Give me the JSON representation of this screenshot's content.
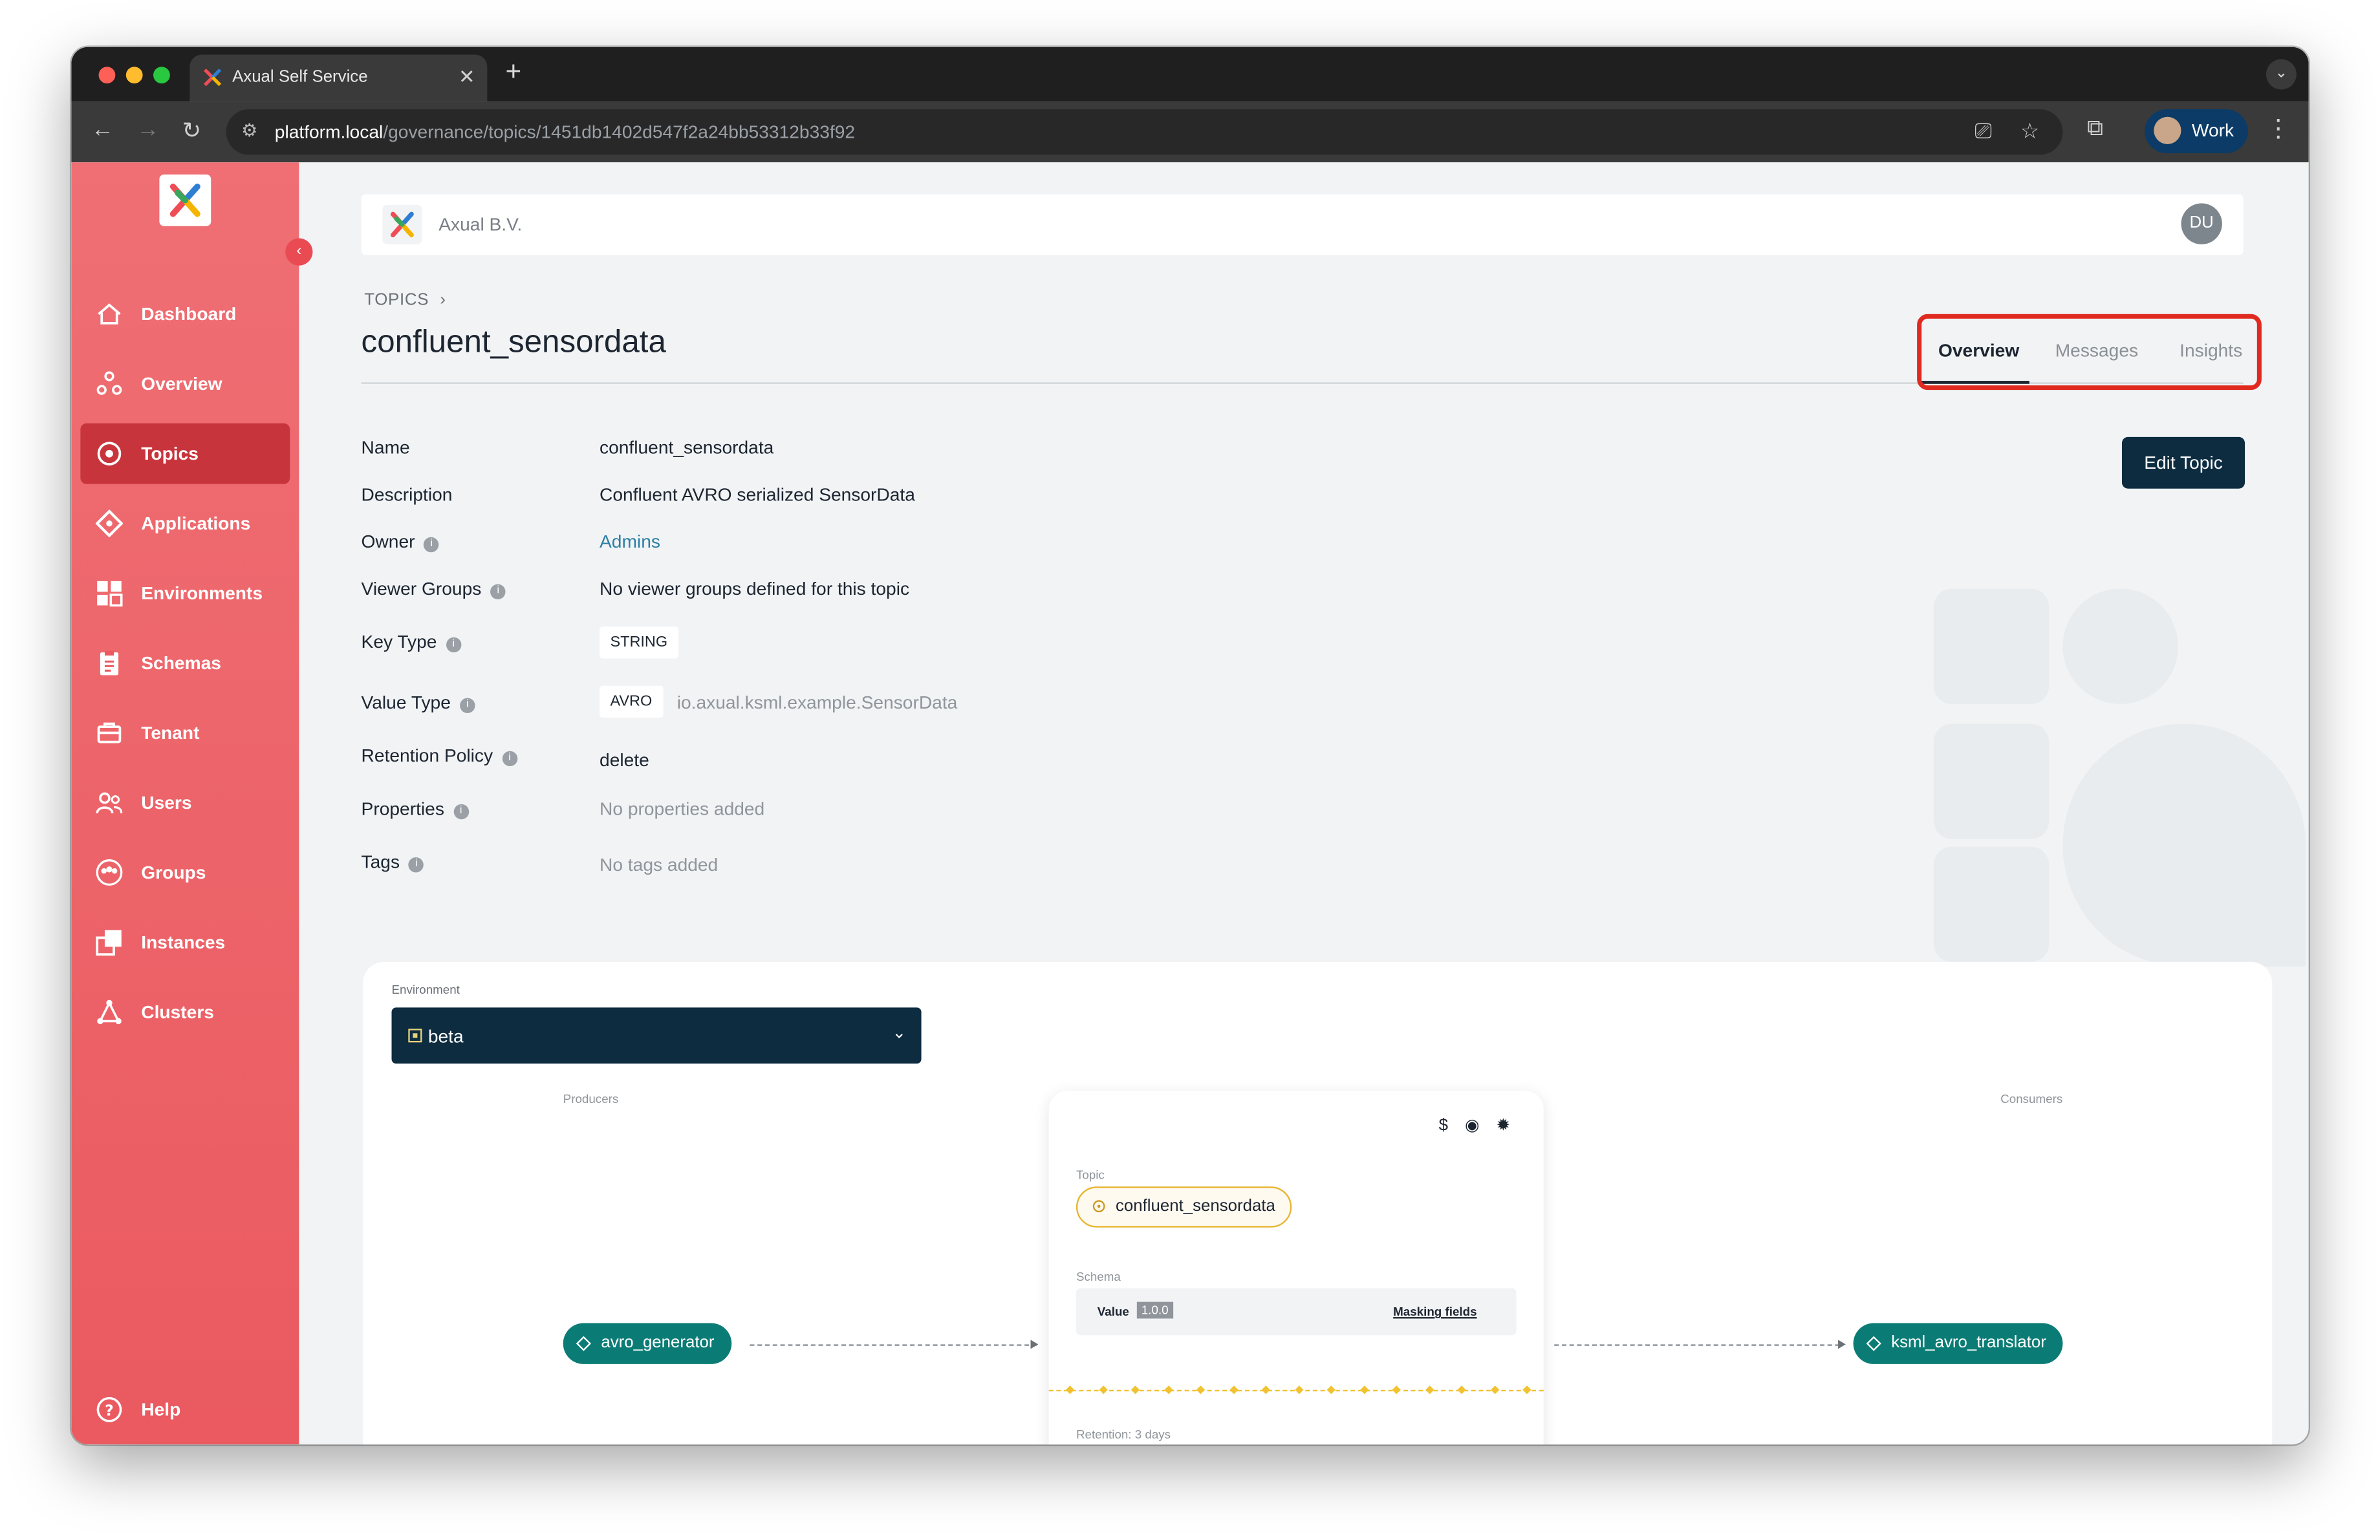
{
  "browser": {
    "tab_title": "Axual Self Service",
    "tab_close": "✕",
    "new_tab": "+",
    "tab_menu": "⌄",
    "url_host": "platform.local",
    "url_path": "/governance/topics/1451db1402d547f2a24bb53312b33f92",
    "profile_label": "Work",
    "icons": [
      "back-icon",
      "forward-icon",
      "reload-icon",
      "site-settings-icon",
      "cast-icon",
      "bookmark-star-icon",
      "extensions-icon",
      "more-menu-icon"
    ]
  },
  "sidebar": {
    "collapse_glyph": "‹",
    "items": [
      {
        "label": "Dashboard",
        "icon": "home-icon",
        "active": false
      },
      {
        "label": "Overview",
        "icon": "overview-icon",
        "active": false
      },
      {
        "label": "Topics",
        "icon": "topic-icon",
        "active": true
      },
      {
        "label": "Applications",
        "icon": "application-icon",
        "active": false
      },
      {
        "label": "Environments",
        "icon": "environment-icon",
        "active": false
      },
      {
        "label": "Schemas",
        "icon": "schema-icon",
        "active": false
      },
      {
        "label": "Tenant",
        "icon": "tenant-icon",
        "active": false
      },
      {
        "label": "Users",
        "icon": "users-icon",
        "active": false
      },
      {
        "label": "Groups",
        "icon": "groups-icon",
        "active": false
      },
      {
        "label": "Instances",
        "icon": "instances-icon",
        "active": false
      },
      {
        "label": "Clusters",
        "icon": "clusters-icon",
        "active": false
      }
    ],
    "help_label": "Help"
  },
  "header": {
    "org_name": "Axual B.V.",
    "user_initials": "DU"
  },
  "page": {
    "breadcrumb": "TOPICS",
    "title": "confluent_sensordata",
    "tabs": [
      "Overview",
      "Messages",
      "Insights"
    ],
    "active_tab": "Overview",
    "edit_button": "Edit Topic",
    "highlight_color": "#e02a1f"
  },
  "details": {
    "name_label": "Name",
    "name_value": "confluent_sensordata",
    "description_label": "Description",
    "description_value": "Confluent AVRO serialized SensorData",
    "owner_label": "Owner",
    "owner_value": "Admins",
    "viewer_groups_label": "Viewer Groups",
    "viewer_groups_value": "No viewer groups defined for this topic",
    "key_type_label": "Key Type",
    "key_type_value": "STRING",
    "value_type_label": "Value Type",
    "value_type_value": "AVRO",
    "value_type_schema": "io.axual.ksml.example.SensorData",
    "retention_label": "Retention Policy",
    "retention_value": "delete",
    "properties_label": "Properties",
    "properties_value": "No properties added",
    "tags_label": "Tags",
    "tags_value": "No tags added"
  },
  "flow": {
    "environment_label": "Environment",
    "environment_value": "beta",
    "producers_label": "Producers",
    "consumers_label": "Consumers",
    "producer": "avro_generator",
    "consumer": "ksml_avro_translator",
    "topic_label": "Topic",
    "topic_name": "confluent_sensordata",
    "schema_label": "Schema",
    "schema_value_label": "Value",
    "schema_version": "1.0.0",
    "masking_link": "Masking fields",
    "retention_text": "Retention: 3 days",
    "card_icons": [
      "$",
      "◉",
      "✹"
    ]
  }
}
